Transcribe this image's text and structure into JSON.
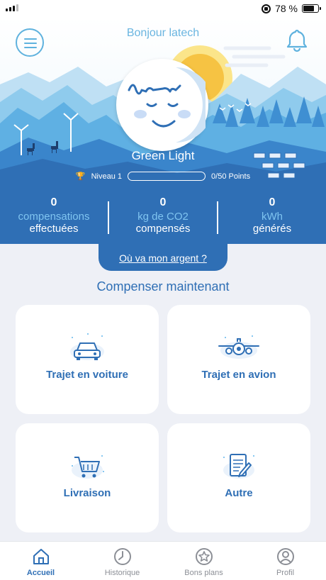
{
  "status_bar": {
    "battery": "78 %",
    "battery_level": 0.78
  },
  "header": {
    "greeting": "Bonjour latech",
    "menu_icon": "menu-icon",
    "notification_icon": "bell-icon"
  },
  "profile": {
    "name": "Green Light",
    "level": "Niveau 1",
    "points": "0/50 Points",
    "progress": 0
  },
  "stats": [
    {
      "value": "0",
      "line1": "compensations",
      "line2": "effectuées"
    },
    {
      "value": "0",
      "line1": "kg de CO2",
      "line2": "compensés"
    },
    {
      "value": "0",
      "line1": "kWh",
      "line2": "générés"
    }
  ],
  "money_link": "Où va mon argent ?",
  "section_title": "Compenser maintenant",
  "actions": [
    {
      "label": "Trajet en voiture",
      "icon": "car-icon"
    },
    {
      "label": "Trajet en avion",
      "icon": "plane-icon"
    },
    {
      "label": "Livraison",
      "icon": "cart-icon"
    },
    {
      "label": "Autre",
      "icon": "document-icon"
    }
  ],
  "tabs": [
    {
      "label": "Accueil",
      "icon": "home-icon",
      "active": true
    },
    {
      "label": "Historique",
      "icon": "clock-icon",
      "active": false
    },
    {
      "label": "Bons plans",
      "icon": "star-icon",
      "active": false
    },
    {
      "label": "Profil",
      "icon": "user-icon",
      "active": false
    }
  ],
  "colors": {
    "primary": "#2f6fb5",
    "light_blue": "#7fc4f0",
    "background": "#eef0f6"
  }
}
